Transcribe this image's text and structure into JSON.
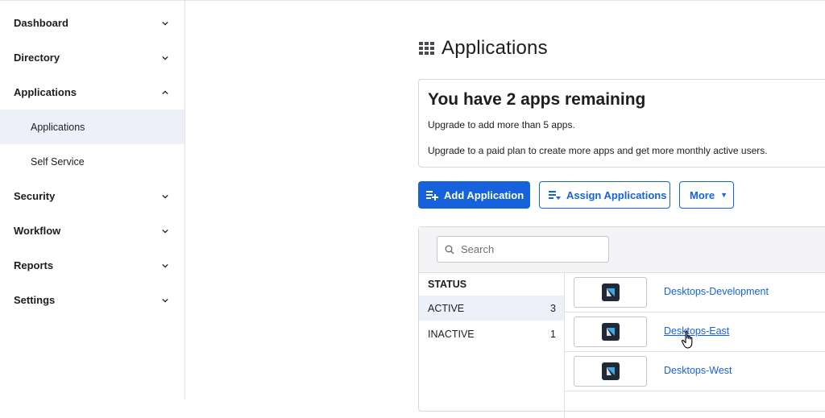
{
  "sidebar": {
    "items": [
      {
        "label": "Dashboard",
        "expanded": false
      },
      {
        "label": "Directory",
        "expanded": false
      },
      {
        "label": "Applications",
        "expanded": true,
        "children": [
          {
            "label": "Applications",
            "active": true
          },
          {
            "label": "Self Service",
            "active": false
          }
        ]
      },
      {
        "label": "Security",
        "expanded": false
      },
      {
        "label": "Workflow",
        "expanded": false
      },
      {
        "label": "Reports",
        "expanded": false
      },
      {
        "label": "Settings",
        "expanded": false
      }
    ]
  },
  "page": {
    "title": "Applications",
    "title_icon": "grid-icon"
  },
  "banner": {
    "title": "You have 2 apps remaining",
    "line1": "Upgrade to add more than 5 apps.",
    "line2": "Upgrade to a paid plan to create more apps and get more monthly active users."
  },
  "toolbar": {
    "add_label": "Add Application",
    "assign_label": "Assign Applications",
    "more_label": "More",
    "more_caret": "▼"
  },
  "search": {
    "placeholder": "Search",
    "value": ""
  },
  "status_filter": {
    "header": "STATUS",
    "rows": [
      {
        "label": "ACTIVE",
        "count": "3",
        "selected": true
      },
      {
        "label": "INACTIVE",
        "count": "1",
        "selected": false
      }
    ]
  },
  "apps": [
    {
      "name": "Desktops-Development",
      "logo": "app-logo-icon"
    },
    {
      "name": "Desktops-East",
      "logo": "app-logo-icon",
      "hovered": true
    },
    {
      "name": "Desktops-West",
      "logo": "app-logo-icon"
    }
  ],
  "colors": {
    "primary": "#1662dd",
    "active_bg": "#eef0f9",
    "text": "#1d1d21",
    "border": "#d7d7dc"
  }
}
